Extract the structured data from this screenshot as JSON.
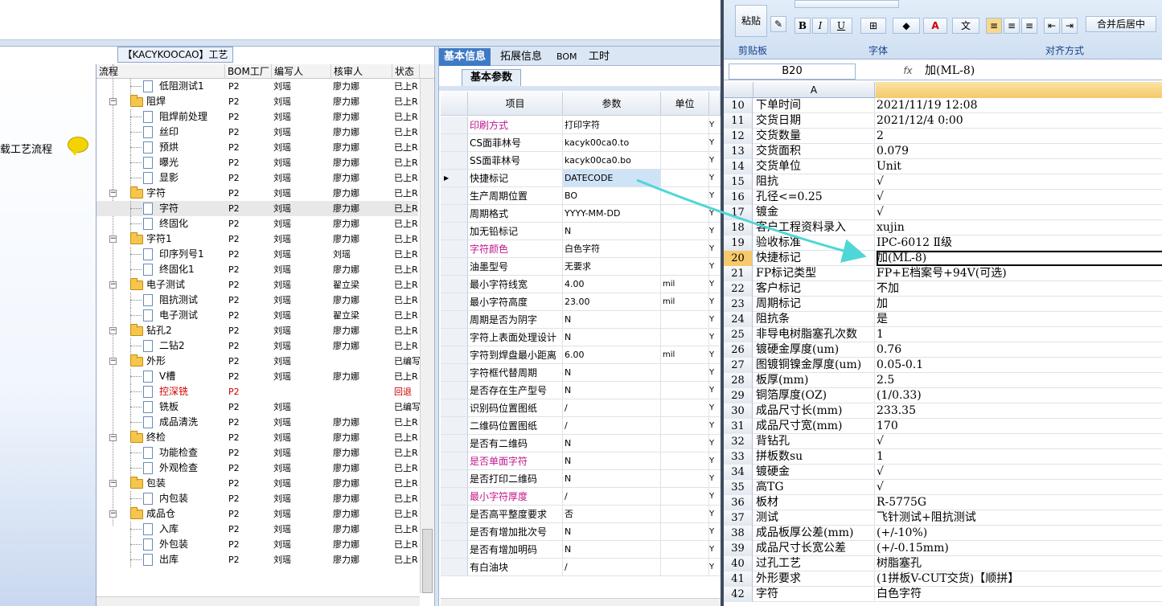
{
  "left_nav": {
    "item_label": "载工艺流程"
  },
  "group_title": "【KACYKOOCAO】工艺流程",
  "process_table": {
    "headers": [
      "流程",
      "BOM工厂",
      "编写人",
      "核审人",
      "状态"
    ],
    "rows": [
      {
        "level": 2,
        "type": "doc",
        "name": "低阻测试1",
        "bom": "P2",
        "writer": "刘瑶",
        "reviewer": "廖力娜",
        "status": "已上R"
      },
      {
        "level": 1,
        "type": "folder",
        "name": "阻焊",
        "bom": "P2",
        "writer": "刘瑶",
        "reviewer": "廖力娜",
        "status": "已上R"
      },
      {
        "level": 2,
        "type": "doc",
        "name": "阻焊前处理",
        "bom": "P2",
        "writer": "刘瑶",
        "reviewer": "廖力娜",
        "status": "已上R"
      },
      {
        "level": 2,
        "type": "doc",
        "name": "丝印",
        "bom": "P2",
        "writer": "刘瑶",
        "reviewer": "廖力娜",
        "status": "已上R"
      },
      {
        "level": 2,
        "type": "doc",
        "name": "预烘",
        "bom": "P2",
        "writer": "刘瑶",
        "reviewer": "廖力娜",
        "status": "已上R"
      },
      {
        "level": 2,
        "type": "doc",
        "name": "曝光",
        "bom": "P2",
        "writer": "刘瑶",
        "reviewer": "廖力娜",
        "status": "已上R"
      },
      {
        "level": 2,
        "type": "doc",
        "name": "显影",
        "bom": "P2",
        "writer": "刘瑶",
        "reviewer": "廖力娜",
        "status": "已上R"
      },
      {
        "level": 1,
        "type": "folder",
        "name": "字符",
        "bom": "P2",
        "writer": "刘瑶",
        "reviewer": "廖力娜",
        "status": "已上R"
      },
      {
        "level": 2,
        "type": "doc",
        "name": "字符",
        "bom": "P2",
        "writer": "刘瑶",
        "reviewer": "廖力娜",
        "status": "已上R",
        "selected": true
      },
      {
        "level": 2,
        "type": "doc",
        "name": "终固化",
        "bom": "P2",
        "writer": "刘瑶",
        "reviewer": "廖力娜",
        "status": "已上R"
      },
      {
        "level": 1,
        "type": "folder",
        "name": "字符1",
        "bom": "P2",
        "writer": "刘瑶",
        "reviewer": "廖力娜",
        "status": "已上R"
      },
      {
        "level": 2,
        "type": "doc",
        "name": "印序列号1",
        "bom": "P2",
        "writer": "刘瑶",
        "reviewer": "刘瑶",
        "status": "已上R"
      },
      {
        "level": 2,
        "type": "doc",
        "name": "终固化1",
        "bom": "P2",
        "writer": "刘瑶",
        "reviewer": "廖力娜",
        "status": "已上R"
      },
      {
        "level": 1,
        "type": "folder",
        "name": "电子测试",
        "bom": "P2",
        "writer": "刘瑶",
        "reviewer": "翟立梁",
        "status": "已上R"
      },
      {
        "level": 2,
        "type": "doc",
        "name": "阻抗测试",
        "bom": "P2",
        "writer": "刘瑶",
        "reviewer": "廖力娜",
        "status": "已上R"
      },
      {
        "level": 2,
        "type": "doc",
        "name": "电子测试",
        "bom": "P2",
        "writer": "刘瑶",
        "reviewer": "翟立梁",
        "status": "已上R"
      },
      {
        "level": 1,
        "type": "folder",
        "name": "钻孔2",
        "bom": "P2",
        "writer": "刘瑶",
        "reviewer": "廖力娜",
        "status": "已上R"
      },
      {
        "level": 2,
        "type": "doc",
        "name": "二钻2",
        "bom": "P2",
        "writer": "刘瑶",
        "reviewer": "廖力娜",
        "status": "已上R"
      },
      {
        "level": 1,
        "type": "folder",
        "name": "外形",
        "bom": "P2",
        "writer": "刘瑶",
        "reviewer": "",
        "status": "已编写"
      },
      {
        "level": 2,
        "type": "doc",
        "name": "V槽",
        "bom": "P2",
        "writer": "刘瑶",
        "reviewer": "廖力娜",
        "status": "已上R"
      },
      {
        "level": 2,
        "type": "doc",
        "name": "控深铣",
        "bom": "P2",
        "writer": "",
        "reviewer": "",
        "status": "回退",
        "red": true
      },
      {
        "level": 2,
        "type": "doc",
        "name": "铣板",
        "bom": "P2",
        "writer": "刘瑶",
        "reviewer": "",
        "status": "已编写"
      },
      {
        "level": 2,
        "type": "doc",
        "name": "成品清洗",
        "bom": "P2",
        "writer": "刘瑶",
        "reviewer": "廖力娜",
        "status": "已上R"
      },
      {
        "level": 1,
        "type": "folder",
        "name": "终检",
        "bom": "P2",
        "writer": "刘瑶",
        "reviewer": "廖力娜",
        "status": "已上R"
      },
      {
        "level": 2,
        "type": "doc",
        "name": "功能检查",
        "bom": "P2",
        "writer": "刘瑶",
        "reviewer": "廖力娜",
        "status": "已上R"
      },
      {
        "level": 2,
        "type": "doc",
        "name": "外观检查",
        "bom": "P2",
        "writer": "刘瑶",
        "reviewer": "廖力娜",
        "status": "已上R"
      },
      {
        "level": 1,
        "type": "folder",
        "name": "包装",
        "bom": "P2",
        "writer": "刘瑶",
        "reviewer": "廖力娜",
        "status": "已上R"
      },
      {
        "level": 2,
        "type": "doc",
        "name": "内包装",
        "bom": "P2",
        "writer": "刘瑶",
        "reviewer": "廖力娜",
        "status": "已上R"
      },
      {
        "level": 1,
        "type": "folder",
        "name": "成品仓",
        "bom": "P2",
        "writer": "刘瑶",
        "reviewer": "廖力娜",
        "status": "已上R"
      },
      {
        "level": 2,
        "type": "doc",
        "name": "入库",
        "bom": "P2",
        "writer": "刘瑶",
        "reviewer": "廖力娜",
        "status": "已上R"
      },
      {
        "level": 2,
        "type": "doc",
        "name": "外包装",
        "bom": "P2",
        "writer": "刘瑶",
        "reviewer": "廖力娜",
        "status": "已上R"
      },
      {
        "level": 2,
        "type": "doc",
        "name": "出库",
        "bom": "P2",
        "writer": "刘瑶",
        "reviewer": "廖力娜",
        "status": "已上R"
      }
    ]
  },
  "tabs": [
    {
      "label": "基本信息",
      "active": true
    },
    {
      "label": "拓展信息"
    },
    {
      "label": "BOM"
    },
    {
      "label": "工时"
    }
  ],
  "subtab": "基本参数",
  "params_table": {
    "headers": [
      "项目",
      "参数",
      "单位"
    ],
    "rows": [
      {
        "label": "印刷方式",
        "value": "打印字符",
        "unit": "",
        "flag": "Y",
        "required": true
      },
      {
        "label": "CS面菲林号",
        "value": "kacyk00ca0.to",
        "unit": "",
        "flag": "Y"
      },
      {
        "label": "SS面菲林号",
        "value": "kacyk00ca0.bo",
        "unit": "",
        "flag": "Y"
      },
      {
        "label": "快捷标记",
        "value": "DATECODE",
        "unit": "",
        "flag": "Y",
        "current": true
      },
      {
        "label": "生产周期位置",
        "value": "BO",
        "unit": "",
        "flag": "Y"
      },
      {
        "label": "周期格式",
        "value": "YYYY-MM-DD",
        "unit": "",
        "flag": "Y"
      },
      {
        "label": "加无铅标记",
        "value": "N",
        "unit": "",
        "flag": "Y"
      },
      {
        "label": "字符颜色",
        "value": "白色字符",
        "unit": "",
        "flag": "Y",
        "required": true
      },
      {
        "label": "油墨型号",
        "value": "无要求",
        "unit": "",
        "flag": "Y"
      },
      {
        "label": "最小字符线宽",
        "value": "4.00",
        "unit": "mil",
        "flag": "Y"
      },
      {
        "label": "最小字符高度",
        "value": "23.00",
        "unit": "mil",
        "flag": "Y"
      },
      {
        "label": "周期是否为阴字",
        "value": "N",
        "unit": "",
        "flag": "Y"
      },
      {
        "label": "字符上表面处理设计",
        "value": "N",
        "unit": "",
        "flag": "Y"
      },
      {
        "label": "字符到焊盘最小距离",
        "value": "6.00",
        "unit": "mil",
        "flag": "Y"
      },
      {
        "label": "字符框代替周期",
        "value": "N",
        "unit": "",
        "flag": "Y"
      },
      {
        "label": "是否存在生产型号",
        "value": "N",
        "unit": "",
        "flag": "Y"
      },
      {
        "label": "识别码位置图纸",
        "value": "/",
        "unit": "",
        "flag": "Y"
      },
      {
        "label": "二维码位置图纸",
        "value": "/",
        "unit": "",
        "flag": "Y"
      },
      {
        "label": "是否有二维码",
        "value": "N",
        "unit": "",
        "flag": "Y"
      },
      {
        "label": "是否单面字符",
        "value": "N",
        "unit": "",
        "flag": "Y",
        "required": true
      },
      {
        "label": "是否打印二维码",
        "value": "N",
        "unit": "",
        "flag": "Y"
      },
      {
        "label": "最小字符厚度",
        "value": "/",
        "unit": "",
        "flag": "Y",
        "required": true
      },
      {
        "label": "是否高平整度要求",
        "value": "否",
        "unit": "",
        "flag": "Y"
      },
      {
        "label": "是否有增加批次号",
        "value": "N",
        "unit": "",
        "flag": "Y"
      },
      {
        "label": "是否有增加明码",
        "value": "N",
        "unit": "",
        "flag": "Y"
      },
      {
        "label": "有白油块",
        "value": "/",
        "unit": "",
        "flag": "Y"
      }
    ]
  },
  "excel": {
    "ribbon": {
      "paste_label": "粘贴",
      "clipboard_group": "剪贴板",
      "font_group": "字体",
      "align_group": "对齐方式",
      "merge_label": "合并后居中",
      "bold": "B",
      "italic": "I",
      "underline": "U"
    },
    "name_box": "B20",
    "fx_label": "fx",
    "formula_value": "加(ML-8)",
    "column_a": "A",
    "rows": [
      {
        "n": "10",
        "a": "下单时间",
        "b": "2021/11/19 12:08"
      },
      {
        "n": "11",
        "a": "交货日期",
        "b": "2021/12/4 0:00"
      },
      {
        "n": "12",
        "a": "交货数量",
        "b": "2"
      },
      {
        "n": "13",
        "a": "交货面积",
        "b": "0.079"
      },
      {
        "n": "14",
        "a": "交货单位",
        "b": "Unit"
      },
      {
        "n": "15",
        "a": "阻抗",
        "b": " √"
      },
      {
        "n": "16",
        "a": "孔径<=0.25",
        "b": " √"
      },
      {
        "n": "17",
        "a": "镀金",
        "b": " √"
      },
      {
        "n": "18",
        "a": "客户工程资料录入",
        "b": "xujin"
      },
      {
        "n": "19",
        "a": "验收标准",
        "b": "IPC-6012 Ⅱ级"
      },
      {
        "n": "20",
        "a": "快捷标记",
        "b": "加(ML-8)",
        "active": true
      },
      {
        "n": "21",
        "a": "FP标记类型",
        "b": "FP+E档案号+94V(可选)"
      },
      {
        "n": "22",
        "a": "客户标记",
        "b": "不加"
      },
      {
        "n": "23",
        "a": "周期标记",
        "b": "加"
      },
      {
        "n": "24",
        "a": "阻抗条",
        "b": "是"
      },
      {
        "n": "25",
        "a": "非导电树脂塞孔次数",
        "b": "1"
      },
      {
        "n": "26",
        "a": "镀硬金厚度(um)",
        "b": "0.76"
      },
      {
        "n": "27",
        "a": "图镀铜镍金厚度(um)",
        "b": "0.05-0.1"
      },
      {
        "n": "28",
        "a": "板厚(mm)",
        "b": "2.5"
      },
      {
        "n": "29",
        "a": "铜箔厚度(OZ)",
        "b": " (1/0.33)"
      },
      {
        "n": "30",
        "a": "成品尺寸长(mm)",
        "b": "233.35"
      },
      {
        "n": "31",
        "a": "成品尺寸宽(mm)",
        "b": "170"
      },
      {
        "n": "32",
        "a": "背钻孔",
        "b": " √"
      },
      {
        "n": "33",
        "a": "拼板数su",
        "b": "1"
      },
      {
        "n": "34",
        "a": "镀硬金",
        "b": " √"
      },
      {
        "n": "35",
        "a": "高TG",
        "b": " √"
      },
      {
        "n": "36",
        "a": "板材",
        "b": "R-5775G"
      },
      {
        "n": "37",
        "a": "测试",
        "b": "飞针测试+阻抗测试"
      },
      {
        "n": "38",
        "a": "成品板厚公差(mm)",
        "b": "(+/-10%)"
      },
      {
        "n": "39",
        "a": "成品尺寸长宽公差",
        "b": "(+/-0.15mm)"
      },
      {
        "n": "40",
        "a": "过孔工艺",
        "b": "树脂塞孔"
      },
      {
        "n": "41",
        "a": "外形要求",
        "b": "(1拼板V-CUT交货)【顺拼】"
      },
      {
        "n": "42",
        "a": "字符",
        "b": "白色字符"
      }
    ]
  },
  "colors": {
    "accent": "#3f7ac4",
    "required_label": "#c0168c",
    "rollback": "#d00000",
    "arrow": "#4fd6d6"
  }
}
